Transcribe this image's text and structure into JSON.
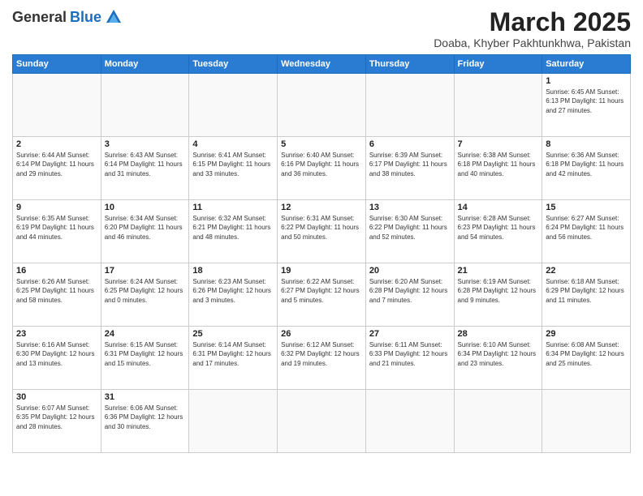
{
  "header": {
    "logo_general": "General",
    "logo_blue": "Blue",
    "title": "March 2025",
    "subtitle": "Doaba, Khyber Pakhtunkhwa, Pakistan"
  },
  "weekdays": [
    "Sunday",
    "Monday",
    "Tuesday",
    "Wednesday",
    "Thursday",
    "Friday",
    "Saturday"
  ],
  "weeks": [
    [
      {
        "day": "",
        "info": ""
      },
      {
        "day": "",
        "info": ""
      },
      {
        "day": "",
        "info": ""
      },
      {
        "day": "",
        "info": ""
      },
      {
        "day": "",
        "info": ""
      },
      {
        "day": "",
        "info": ""
      },
      {
        "day": "1",
        "info": "Sunrise: 6:45 AM\nSunset: 6:13 PM\nDaylight: 11 hours\nand 27 minutes."
      }
    ],
    [
      {
        "day": "2",
        "info": "Sunrise: 6:44 AM\nSunset: 6:14 PM\nDaylight: 11 hours\nand 29 minutes."
      },
      {
        "day": "3",
        "info": "Sunrise: 6:43 AM\nSunset: 6:14 PM\nDaylight: 11 hours\nand 31 minutes."
      },
      {
        "day": "4",
        "info": "Sunrise: 6:41 AM\nSunset: 6:15 PM\nDaylight: 11 hours\nand 33 minutes."
      },
      {
        "day": "5",
        "info": "Sunrise: 6:40 AM\nSunset: 6:16 PM\nDaylight: 11 hours\nand 36 minutes."
      },
      {
        "day": "6",
        "info": "Sunrise: 6:39 AM\nSunset: 6:17 PM\nDaylight: 11 hours\nand 38 minutes."
      },
      {
        "day": "7",
        "info": "Sunrise: 6:38 AM\nSunset: 6:18 PM\nDaylight: 11 hours\nand 40 minutes."
      },
      {
        "day": "8",
        "info": "Sunrise: 6:36 AM\nSunset: 6:18 PM\nDaylight: 11 hours\nand 42 minutes."
      }
    ],
    [
      {
        "day": "9",
        "info": "Sunrise: 6:35 AM\nSunset: 6:19 PM\nDaylight: 11 hours\nand 44 minutes."
      },
      {
        "day": "10",
        "info": "Sunrise: 6:34 AM\nSunset: 6:20 PM\nDaylight: 11 hours\nand 46 minutes."
      },
      {
        "day": "11",
        "info": "Sunrise: 6:32 AM\nSunset: 6:21 PM\nDaylight: 11 hours\nand 48 minutes."
      },
      {
        "day": "12",
        "info": "Sunrise: 6:31 AM\nSunset: 6:22 PM\nDaylight: 11 hours\nand 50 minutes."
      },
      {
        "day": "13",
        "info": "Sunrise: 6:30 AM\nSunset: 6:22 PM\nDaylight: 11 hours\nand 52 minutes."
      },
      {
        "day": "14",
        "info": "Sunrise: 6:28 AM\nSunset: 6:23 PM\nDaylight: 11 hours\nand 54 minutes."
      },
      {
        "day": "15",
        "info": "Sunrise: 6:27 AM\nSunset: 6:24 PM\nDaylight: 11 hours\nand 56 minutes."
      }
    ],
    [
      {
        "day": "16",
        "info": "Sunrise: 6:26 AM\nSunset: 6:25 PM\nDaylight: 11 hours\nand 58 minutes."
      },
      {
        "day": "17",
        "info": "Sunrise: 6:24 AM\nSunset: 6:25 PM\nDaylight: 12 hours\nand 0 minutes."
      },
      {
        "day": "18",
        "info": "Sunrise: 6:23 AM\nSunset: 6:26 PM\nDaylight: 12 hours\nand 3 minutes."
      },
      {
        "day": "19",
        "info": "Sunrise: 6:22 AM\nSunset: 6:27 PM\nDaylight: 12 hours\nand 5 minutes."
      },
      {
        "day": "20",
        "info": "Sunrise: 6:20 AM\nSunset: 6:28 PM\nDaylight: 12 hours\nand 7 minutes."
      },
      {
        "day": "21",
        "info": "Sunrise: 6:19 AM\nSunset: 6:28 PM\nDaylight: 12 hours\nand 9 minutes."
      },
      {
        "day": "22",
        "info": "Sunrise: 6:18 AM\nSunset: 6:29 PM\nDaylight: 12 hours\nand 11 minutes."
      }
    ],
    [
      {
        "day": "23",
        "info": "Sunrise: 6:16 AM\nSunset: 6:30 PM\nDaylight: 12 hours\nand 13 minutes."
      },
      {
        "day": "24",
        "info": "Sunrise: 6:15 AM\nSunset: 6:31 PM\nDaylight: 12 hours\nand 15 minutes."
      },
      {
        "day": "25",
        "info": "Sunrise: 6:14 AM\nSunset: 6:31 PM\nDaylight: 12 hours\nand 17 minutes."
      },
      {
        "day": "26",
        "info": "Sunrise: 6:12 AM\nSunset: 6:32 PM\nDaylight: 12 hours\nand 19 minutes."
      },
      {
        "day": "27",
        "info": "Sunrise: 6:11 AM\nSunset: 6:33 PM\nDaylight: 12 hours\nand 21 minutes."
      },
      {
        "day": "28",
        "info": "Sunrise: 6:10 AM\nSunset: 6:34 PM\nDaylight: 12 hours\nand 23 minutes."
      },
      {
        "day": "29",
        "info": "Sunrise: 6:08 AM\nSunset: 6:34 PM\nDaylight: 12 hours\nand 25 minutes."
      }
    ],
    [
      {
        "day": "30",
        "info": "Sunrise: 6:07 AM\nSunset: 6:35 PM\nDaylight: 12 hours\nand 28 minutes."
      },
      {
        "day": "31",
        "info": "Sunrise: 6:06 AM\nSunset: 6:36 PM\nDaylight: 12 hours\nand 30 minutes."
      },
      {
        "day": "",
        "info": ""
      },
      {
        "day": "",
        "info": ""
      },
      {
        "day": "",
        "info": ""
      },
      {
        "day": "",
        "info": ""
      },
      {
        "day": "",
        "info": ""
      }
    ]
  ]
}
